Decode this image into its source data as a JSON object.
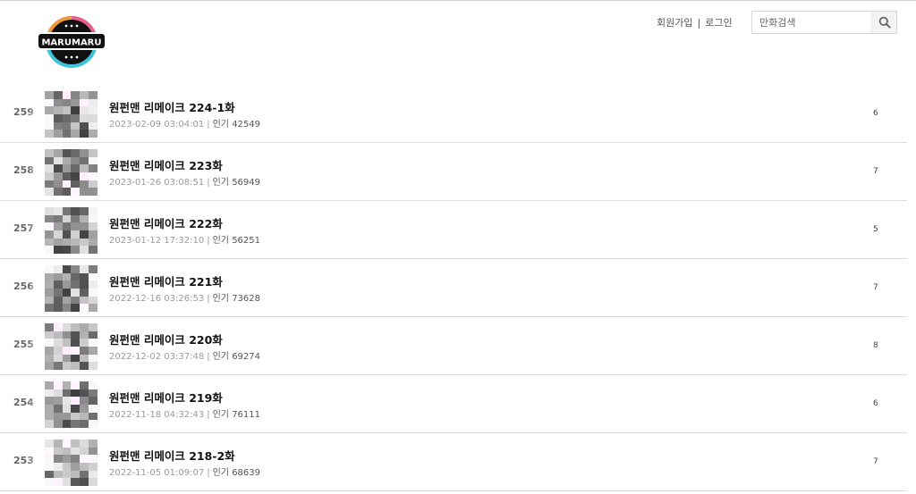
{
  "header": {
    "logo_text": "MARUMARU",
    "signup_label": "회원가입",
    "separator": "|",
    "login_label": "로그인",
    "search": {
      "placeholder": "만화검색",
      "value": ""
    },
    "icons": {
      "search": "search-icon"
    }
  },
  "colors": {
    "logo_ring_cyan": "#3fc3d8",
    "logo_ring_pink": "#ec5d8f",
    "logo_ring_orange": "#f29a3a",
    "logo_face": "#111111",
    "divider": "#dcdcdc"
  },
  "episodes": [
    {
      "number": "259",
      "title": "원펀맨 리메이크 224-1화",
      "date": "2023-02-09 03:04:01",
      "popularity_label": "인기",
      "popularity": "42549",
      "count": "6",
      "thumb_seed": 3
    },
    {
      "number": "258",
      "title": "원펀맨 리메이크 223화",
      "date": "2023-01-26 03:08:51",
      "popularity_label": "인기",
      "popularity": "56949",
      "count": "7",
      "thumb_seed": 7
    },
    {
      "number": "257",
      "title": "원펀맨 리메이크 222화",
      "date": "2023-01-12 17:32:10",
      "popularity_label": "인기",
      "popularity": "56251",
      "count": "5",
      "thumb_seed": 11
    },
    {
      "number": "256",
      "title": "원펀맨 리메이크 221화",
      "date": "2022-12-16 03:26:53",
      "popularity_label": "인기",
      "popularity": "73628",
      "count": "7",
      "thumb_seed": 17
    },
    {
      "number": "255",
      "title": "원펀맨 리메이크 220화",
      "date": "2022-12-02 03:37:48",
      "popularity_label": "인기",
      "popularity": "69274",
      "count": "8",
      "thumb_seed": 23
    },
    {
      "number": "254",
      "title": "원펀맨 리메이크 219화",
      "date": "2022-11-18 04:32:43",
      "popularity_label": "인기",
      "popularity": "76111",
      "count": "6",
      "thumb_seed": 29
    },
    {
      "number": "253",
      "title": "원펀맨 리메이크 218-2화",
      "date": "2022-11-05 01:09:07",
      "popularity_label": "인기",
      "popularity": "68639",
      "count": "7",
      "thumb_seed": 37
    }
  ]
}
